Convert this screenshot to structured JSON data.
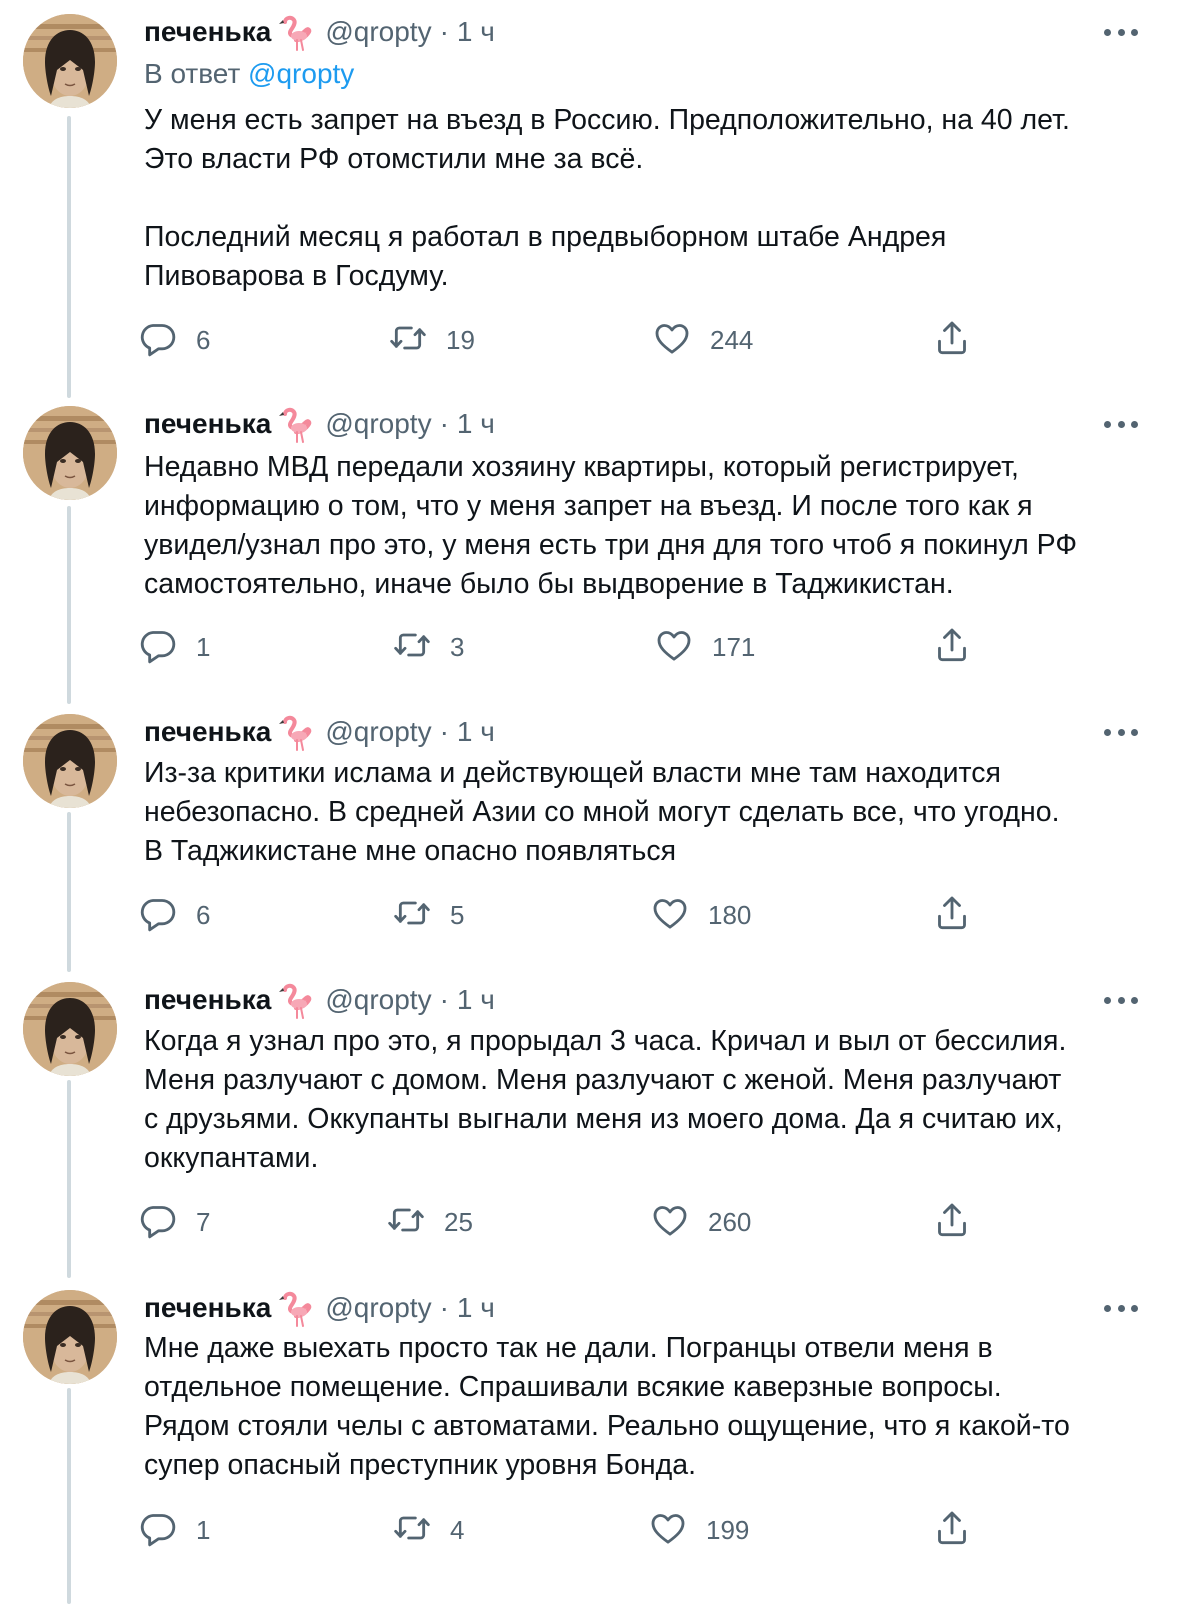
{
  "author": {
    "display_name": "печенька",
    "emoji_icon": "flamingo-icon",
    "handle": "@qropty",
    "separator": "·",
    "time": "1 ч"
  },
  "reply_to": {
    "prefix": "В ответ",
    "mention": "@qropty"
  },
  "tweets": [
    {
      "lines": [
        "У меня есть запрет на въезд в Россию. Предположительно, на 40 лет.",
        "Это власти РФ отомстили мне за всё.",
        "",
        "Последний месяц я работал в предвыборном штабе Андрея",
        "Пивоварова в Госдуму."
      ],
      "replies": "6",
      "retweets": "19",
      "likes": "244"
    },
    {
      "lines": [
        "Недавно МВД передали хозяину квартиры, который регистрирует,",
        "информацию о том, что у меня запрет на въезд. И после того как я",
        "увидел/узнал про это, у меня есть три дня для того чтоб я покинул РФ",
        "самостоятельно, иначе было бы выдворение в Таджикистан."
      ],
      "replies": "1",
      "retweets": "3",
      "likes": "171"
    },
    {
      "lines": [
        "Из-за критики ислама и действующей власти мне там находится",
        "небезопасно. В средней Азии со мной могут сделать все, что угодно.",
        "В Таджикистане мне опасно появляться"
      ],
      "replies": "6",
      "retweets": "5",
      "likes": "180"
    },
    {
      "lines": [
        "Когда я узнал про это, я прорыдал 3 часа. Кричал и выл от бессилия.",
        "Меня разлучают с домом. Меня разлучают с женой. Меня разлучают",
        "с друзьями. Оккупанты выгнали меня из моего дома. Да я считаю их,",
        "оккупантами."
      ],
      "replies": "7",
      "retweets": "25",
      "likes": "260"
    },
    {
      "lines": [
        "Мне даже выехать просто так не дали. Погранцы отвели меня в",
        "отдельное помещение. Спрашивали всякие каверзные вопросы.",
        "Рядом стояли челы с автоматами. Реально ощущение, что я какой-то",
        "супер опасный преступник уровня Бонда."
      ],
      "replies": "1",
      "retweets": "4",
      "likes": "199"
    }
  ],
  "colors": {
    "text": "#0f1419",
    "secondary": "#536471",
    "link": "#1d9bf0",
    "thread_line": "#cfd9de"
  }
}
